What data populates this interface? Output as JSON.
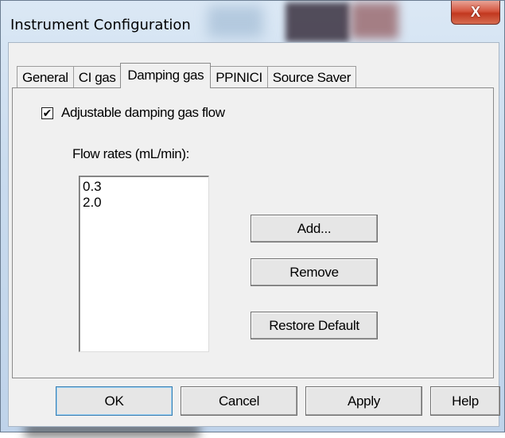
{
  "window": {
    "title": "Instrument Configuration",
    "close_glyph": "X"
  },
  "tabs": [
    {
      "label": "General",
      "active": false
    },
    {
      "label": "CI gas",
      "active": false
    },
    {
      "label": "Damping gas",
      "active": true
    },
    {
      "label": "PPINICI",
      "active": false
    },
    {
      "label": "Source Saver",
      "active": false
    }
  ],
  "damping": {
    "checkbox_label": "Adjustable damping gas flow",
    "checkbox_checked": true,
    "check_glyph": "✔",
    "flow_label": "Flow rates (mL/min):",
    "flow_rates": [
      "0.3",
      "2.0"
    ],
    "add_label": "Add...",
    "remove_label": "Remove",
    "restore_label": "Restore Default"
  },
  "footer": {
    "ok_label": "OK",
    "cancel_label": "Cancel",
    "apply_label": "Apply",
    "help_label": "Help"
  },
  "colors": {
    "close_button": "#c2381f",
    "default_button_border": "#3c7fb1"
  }
}
